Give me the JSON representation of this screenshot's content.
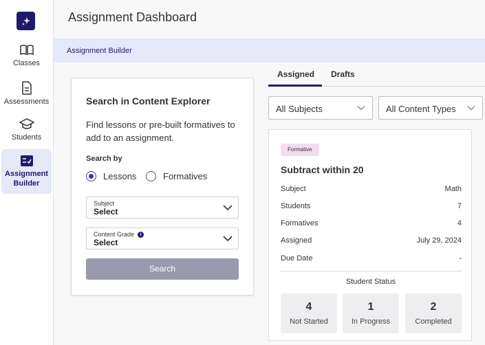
{
  "sidebar": {
    "items": [
      {
        "label": "Classes",
        "icon": "book-icon"
      },
      {
        "label": "Assessments",
        "icon": "document-icon"
      },
      {
        "label": "Students",
        "icon": "graduation-cap-icon"
      },
      {
        "label": "Assignment Builder",
        "icon": "checklist-icon",
        "active": true
      }
    ]
  },
  "header": {
    "title": "Assignment Dashboard"
  },
  "breadcrumb": {
    "label": "Assignment Builder"
  },
  "explorer": {
    "title": "Search in Content Explorer",
    "description": "Find lessons or pre-built formatives to add to an assignment.",
    "search_by_label": "Search by",
    "options": [
      {
        "label": "Lessons",
        "selected": true
      },
      {
        "label": "Formatives",
        "selected": false
      }
    ],
    "subject": {
      "label": "Subject",
      "value": "Select"
    },
    "grade": {
      "label": "Content Grade",
      "value": "Select"
    },
    "search_button": "Search"
  },
  "tabs": [
    {
      "label": "Assigned",
      "active": true
    },
    {
      "label": "Drafts",
      "active": false
    }
  ],
  "filters": {
    "subjects": "All Subjects",
    "content_types": "All Content Types"
  },
  "assignment": {
    "badge": "Formative",
    "title": "Subtract within 20",
    "rows": [
      {
        "label": "Subject",
        "value": "Math"
      },
      {
        "label": "Students",
        "value": "7"
      },
      {
        "label": "Formatives",
        "value": "4"
      },
      {
        "label": "Assigned",
        "value": "July 29, 2024"
      },
      {
        "label": "Due Date",
        "value": "-"
      }
    ],
    "status_title": "Student Status",
    "stats": [
      {
        "count": "4",
        "label": "Not Started"
      },
      {
        "count": "1",
        "label": "In Progress"
      },
      {
        "count": "2",
        "label": "Completed"
      }
    ]
  },
  "colors": {
    "brand": "#1f1b6b",
    "banner": "#e4eafb",
    "badge": "#f3dcee"
  }
}
